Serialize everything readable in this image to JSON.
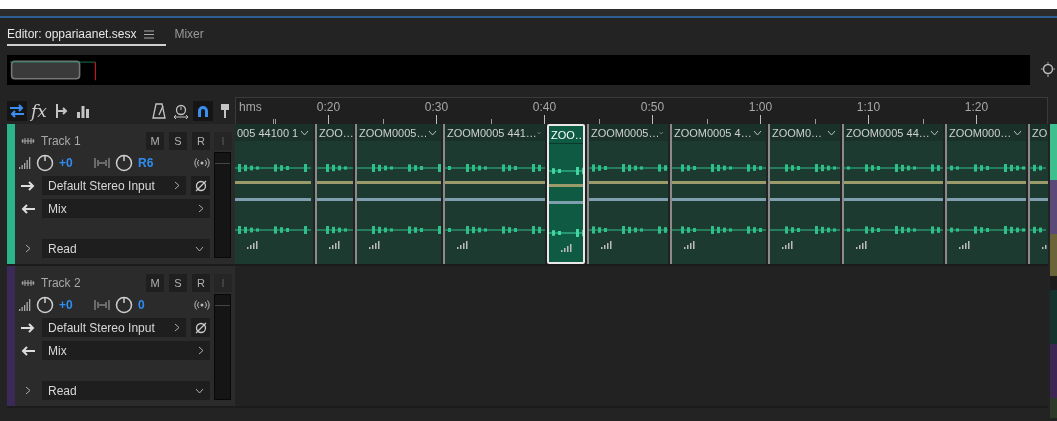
{
  "tabs": [
    {
      "label": "Editor: oppariaanet.sesx",
      "selected": true,
      "menu": true
    },
    {
      "label": "Mixer",
      "selected": false,
      "menu": false
    }
  ],
  "toolbar_left": [
    {
      "kind": "swap",
      "selected": true
    },
    {
      "kind": "fx",
      "label": "fx",
      "selected": false
    },
    {
      "kind": "route",
      "selected": false
    },
    {
      "kind": "bars",
      "selected": false
    }
  ],
  "toolbar_right": [
    {
      "kind": "metronome",
      "selected": false
    },
    {
      "kind": "stopwatch",
      "selected": false
    },
    {
      "kind": "magnet",
      "selected": true
    },
    {
      "kind": "pin",
      "selected": false
    }
  ],
  "ruler": {
    "unit": "hms",
    "labels": [
      "0:20",
      "0:30",
      "0:40",
      "0:50",
      "1:00",
      "1:10",
      "1:20"
    ]
  },
  "tracks": [
    {
      "name": "Track 1",
      "color": "#2db38a",
      "volume": "+0",
      "pan": "R6",
      "input": "Default Stereo Input",
      "output": "Mix",
      "automation": "Read",
      "expanded": false,
      "buttons": [
        {
          "label": "M",
          "on": false,
          "disabled": false
        },
        {
          "label": "S",
          "on": false,
          "disabled": false
        },
        {
          "label": "R",
          "on": false,
          "disabled": false
        },
        {
          "label": "I",
          "on": false,
          "disabled": true
        }
      ],
      "clips": [
        {
          "name": "005 44100 1",
          "menu": true,
          "selected": false
        },
        {
          "name": "ZOO…",
          "menu": false,
          "selected": false
        },
        {
          "name": "ZOOM0005…",
          "menu": true,
          "selected": false
        },
        {
          "name": "ZOOM0005 441…",
          "menu": true,
          "selected": false
        },
        {
          "name": "ZOO…",
          "menu": false,
          "selected": true
        },
        {
          "name": "ZOOM0005…",
          "menu": true,
          "selected": false
        },
        {
          "name": "ZOOM0005 4…",
          "menu": true,
          "selected": false
        },
        {
          "name": "ZOOM0…",
          "menu": true,
          "selected": false
        },
        {
          "name": "ZOOM0005 44…",
          "menu": true,
          "selected": false
        },
        {
          "name": "ZOOM000…",
          "menu": true,
          "selected": false
        },
        {
          "name": "ZO",
          "menu": false,
          "selected": false
        }
      ]
    },
    {
      "name": "Track 2",
      "color": "#3b2a58",
      "volume": "+0",
      "pan": "0",
      "input": "Default Stereo Input",
      "output": "Mix",
      "automation": "Read",
      "expanded": false,
      "buttons": [
        {
          "label": "M",
          "on": false,
          "disabled": false
        },
        {
          "label": "S",
          "on": false,
          "disabled": false
        },
        {
          "label": "R",
          "on": false,
          "disabled": false
        },
        {
          "label": "I",
          "on": false,
          "disabled": true
        }
      ]
    }
  ]
}
